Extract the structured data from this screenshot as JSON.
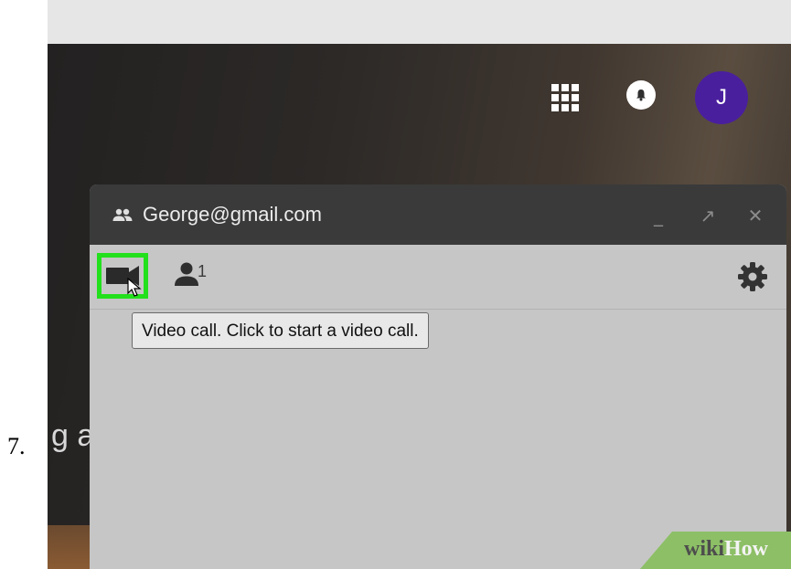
{
  "step": {
    "number": "7."
  },
  "topbar": {
    "avatar_letter": "J",
    "avatar_color": "#4a1f9e",
    "apps_icon": "apps-grid-icon",
    "notifications_icon": "bell-icon"
  },
  "background": {
    "partial_text": "g a"
  },
  "chat": {
    "title": "George@gmail.com",
    "header_icon": "people-icon",
    "minimize_label": "_",
    "popout_label": "↗",
    "close_label": "✕",
    "participant_count": "1",
    "video_button_highlight_color": "#22e01c",
    "tooltip": "Video call. Click to start a video call."
  },
  "watermark": {
    "part1": "wiki",
    "part2": "How"
  }
}
